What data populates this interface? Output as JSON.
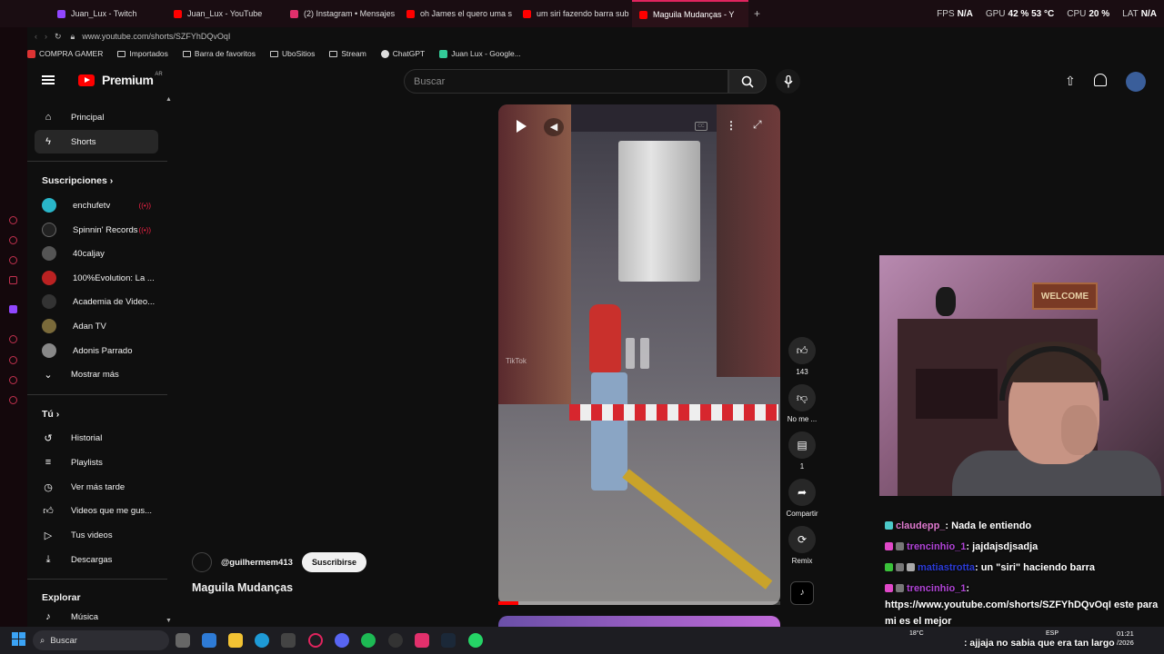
{
  "browser": {
    "tabs": [
      {
        "label": "Juan_Lux - Twitch",
        "color": "#9146ff"
      },
      {
        "label": "Juan_Lux - YouTube",
        "color": "#ff0000"
      },
      {
        "label": "(2) Instagram • Mensajes",
        "color": "#e1306c"
      },
      {
        "label": "oh James el quero uma s",
        "color": "#ff0000"
      },
      {
        "label": "um siri fazendo barra sub",
        "color": "#ff0000"
      },
      {
        "label": "Maguila Mudanças - Y",
        "color": "#ff0000"
      }
    ],
    "url": "www.youtube.com/shorts/SZFYhDQvOqI",
    "bookmarks": [
      "COMPRA GAMER",
      "Importados",
      "Barra de favoritos",
      "UboSitios",
      "Stream",
      "ChatGPT",
      "Juan Lux - Google..."
    ],
    "sysmon": {
      "fps_label": "FPS",
      "fps": "N/A",
      "gpu_label": "GPU",
      "gpu": "42 % 53 °C",
      "cpu_label": "CPU",
      "cpu": "20 %",
      "lat_label": "LAT",
      "lat": "N/A"
    }
  },
  "youtube": {
    "logo": "Premium",
    "logo_region": "AR",
    "search_placeholder": "Buscar",
    "sidebar": {
      "main": [
        {
          "label": "Principal",
          "icon": "home-icon"
        },
        {
          "label": "Shorts",
          "icon": "shorts-icon"
        }
      ],
      "subs_title": "Suscripciones",
      "subs": [
        {
          "label": "enchufetv",
          "color": "#29b6c9",
          "live": true
        },
        {
          "label": "Spinnin' Records",
          "color": "#222",
          "live": true
        },
        {
          "label": "40caljay",
          "color": "#555",
          "live": false
        },
        {
          "label": "100%Evolution: La ...",
          "color": "#b22",
          "live": false
        },
        {
          "label": "Academia de Video...",
          "color": "#333",
          "live": false
        },
        {
          "label": "Adan TV",
          "color": "#7a6a3a",
          "live": false
        },
        {
          "label": "Adonis Parrado",
          "color": "#888",
          "live": false
        }
      ],
      "show_more": "Mostrar más",
      "you_title": "Tú",
      "you": [
        {
          "label": "Historial"
        },
        {
          "label": "Playlists"
        },
        {
          "label": "Ver más tarde"
        },
        {
          "label": "Videos que me gus..."
        },
        {
          "label": "Tus videos"
        },
        {
          "label": "Descargas"
        }
      ],
      "explore_title": "Explorar",
      "explore": [
        {
          "label": "Música"
        }
      ]
    },
    "short": {
      "channel": "@guilhermem413",
      "subscribe": "Suscribirse",
      "title": "Maguila Mudanças",
      "watermark": "TikTok",
      "progress_fraction": 0.07,
      "likes": "143",
      "dislike_label": "No me ...",
      "comments": "1",
      "share_label": "Compartir",
      "remix_label": "Remix"
    }
  },
  "webcam": {
    "sign": "WELCOME"
  },
  "chat": [
    {
      "user": "claudepp_",
      "color": "#e07bd0",
      "text": ": Nada le entiendo",
      "badge": "#4cc9c9"
    },
    {
      "user": "trencinhio_1",
      "color": "#b044d6",
      "text": ": jajdajsdjsadja",
      "badge": "#e048c8"
    },
    {
      "user": "matiastrotta",
      "color": "#2b3bd6",
      "text": ": un \"siri\" haciendo barra",
      "badge": "#3ac23a"
    },
    {
      "user": "trencinhio_1",
      "color": "#b044d6",
      "text": ":",
      "badge": "#e048c8"
    },
    {
      "user": "",
      "color": "#fff",
      "text": "https://www.youtube.com/shorts/SZFYhDQvOqI este para mi es el mejor",
      "badge": ""
    },
    {
      "user": "",
      "color": "#fff",
      "text": ": ajjaja no sabia que era tan largo",
      "badge": "#d33"
    }
  ],
  "taskbar": {
    "search": "Buscar",
    "weather": "18°C",
    "lang": "ESP",
    "time": "01:21",
    "date": "/2026"
  }
}
